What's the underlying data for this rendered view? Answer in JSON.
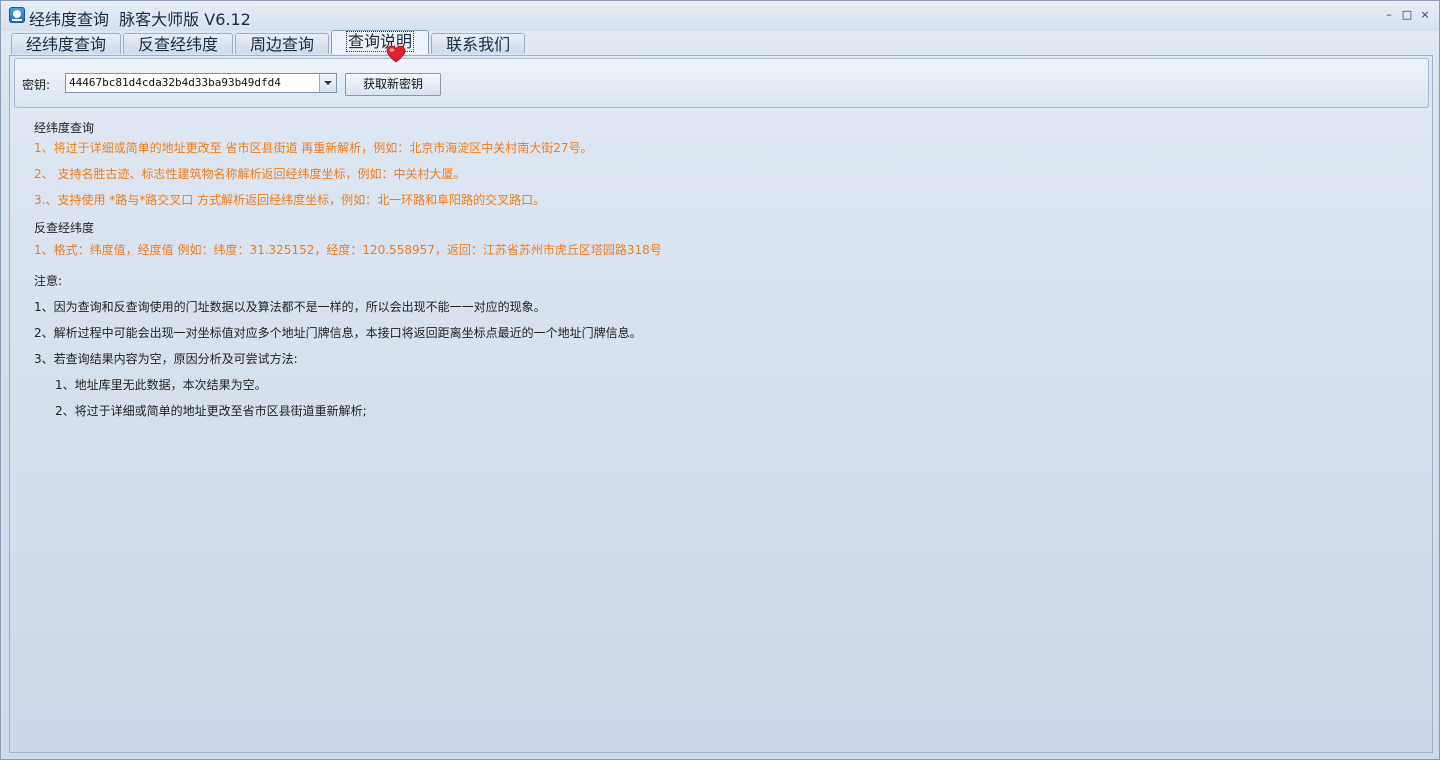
{
  "window": {
    "title": "经纬度查询  脉客大师版 V6.12",
    "controls": {
      "minimize": "–",
      "maximize": "□",
      "close": "×"
    }
  },
  "tabs": [
    {
      "label": "经纬度查询",
      "active": false
    },
    {
      "label": "反查经纬度",
      "active": false
    },
    {
      "label": "周边查询",
      "active": false
    },
    {
      "label": "查询说明",
      "active": true
    },
    {
      "label": "联系我们",
      "active": false
    }
  ],
  "key": {
    "label": "密钥:",
    "value": "44467bc81d4cda32b4d33ba93b49dfd4",
    "button": "获取新密钥"
  },
  "doc": {
    "section1_title": "经纬度查询",
    "section1_items": [
      "1、将过于详细或简单的地址更改至 省市区县街道 再重新解析，例如：北京市海淀区中关村南大街27号。",
      "2、 支持名胜古迹、标志性建筑物名称解析返回经纬度坐标，例如：中关村大厦。",
      "3.、支持使用 *路与*路交叉口 方式解析返回经纬度坐标，例如：北一环路和阜阳路的交叉路口。"
    ],
    "section2_title": "反查经纬度",
    "section2_items": [
      "1、格式：纬度值，经度值 例如：纬度：31.325152，经度：120.558957，返回：江苏省苏州市虎丘区塔园路318号"
    ],
    "notes_title": "注意:",
    "notes": [
      "1、因为查询和反查询使用的门址数据以及算法都不是一样的，所以会出现不能一一对应的现象。",
      "2、解析过程中可能会出现一对坐标值对应多个地址门牌信息，本接口将返回距离坐标点最近的一个地址门牌信息。",
      "3、若查询结果内容为空，原因分析及可尝试方法:"
    ],
    "subnotes": [
      "1、地址库里无此数据，本次结果为空。",
      "2、将过于详细或简单的地址更改至省市区县街道重新解析;"
    ]
  },
  "colors": {
    "highlight_text": "#ee7d1f",
    "normal_text": "#222222"
  }
}
